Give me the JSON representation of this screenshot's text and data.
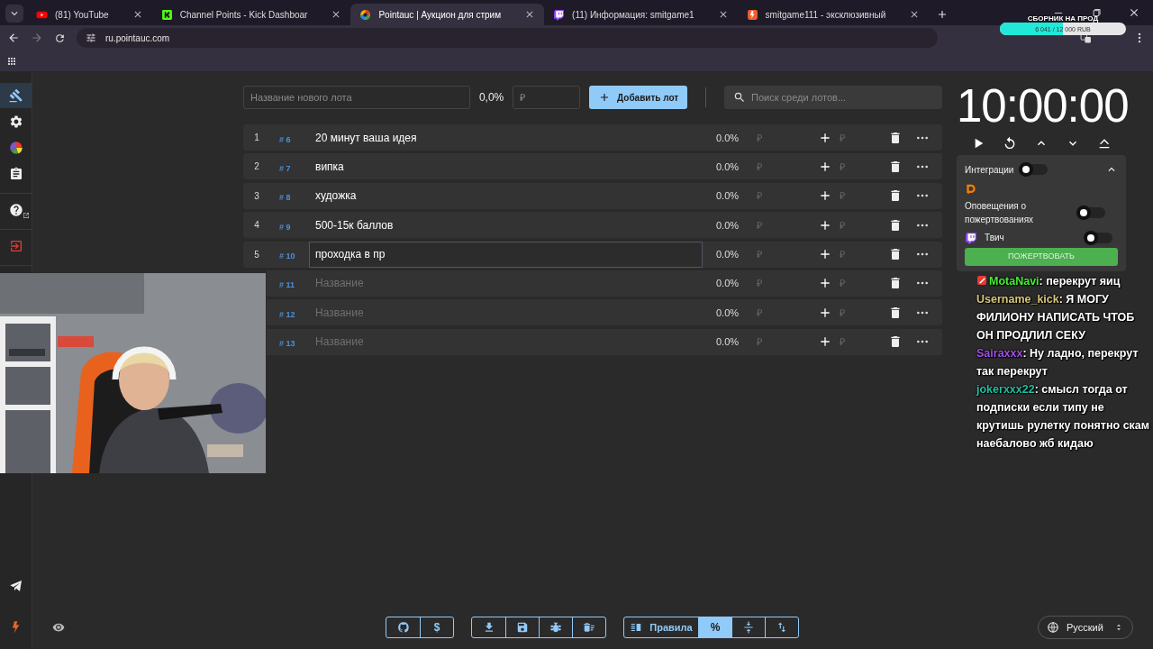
{
  "browser": {
    "tabs": [
      {
        "kind": "youtube",
        "title": "(81) YouTube",
        "selected": false
      },
      {
        "kind": "kick",
        "title": "Channel Points - Kick Dashboar",
        "selected": false
      },
      {
        "kind": "pointauc",
        "title": "Pointauc | Аукцион для стрим",
        "selected": true
      },
      {
        "kind": "twitch",
        "title": "(11) Информация: smitgame1",
        "selected": false
      },
      {
        "kind": "boosty",
        "title": "smitgame111 - эксклюзивный",
        "selected": false
      }
    ],
    "url": "ru.pointauc.com"
  },
  "donation_goal": {
    "title": "СБОРНИК НА ПРОД",
    "amount": "6 041 / 12 000 RUB",
    "level": 0.5
  },
  "sidebar": {
    "sections": [
      [
        {
          "kind": "gavel",
          "selected": true
        },
        {
          "kind": "gear",
          "selected": false
        },
        {
          "kind": "pie",
          "selected": false
        },
        {
          "kind": "clipboard",
          "selected": false
        }
      ],
      [
        {
          "kind": "help",
          "selected": false
        }
      ],
      [
        {
          "kind": "logout",
          "selected": false
        }
      ]
    ],
    "footer": [
      {
        "kind": "telegram"
      },
      {
        "kind": "boosty"
      }
    ]
  },
  "new_lot": {
    "name_placeholder": "Название нового лота",
    "percent": "0,0%",
    "amount_placeholder": "₽",
    "add_button": "Добавить лот"
  },
  "search": {
    "placeholder": "Поиск среди лотов..."
  },
  "lots": [
    {
      "number": "1",
      "tag": "# 6",
      "name": "20 минут ваша идея",
      "percent": "0.0%",
      "amount_placeholder": "₽",
      "add_placeholder": "₽",
      "focused": false
    },
    {
      "number": "2",
      "tag": "# 7",
      "name": "випка",
      "percent": "0.0%",
      "amount_placeholder": "₽",
      "add_placeholder": "₽",
      "focused": false
    },
    {
      "number": "3",
      "tag": "# 8",
      "name": "художка",
      "percent": "0.0%",
      "amount_placeholder": "₽",
      "add_placeholder": "₽",
      "focused": false
    },
    {
      "number": "4",
      "tag": "# 9",
      "name": "500-15к баллов",
      "percent": "0.0%",
      "amount_placeholder": "₽",
      "add_placeholder": "₽",
      "focused": false
    },
    {
      "number": "5",
      "tag": "# 10",
      "name": "проходка в пр",
      "percent": "0.0%",
      "amount_placeholder": "₽",
      "add_placeholder": "₽",
      "focused": true
    },
    {
      "tag": "# 11",
      "name_placeholder": "Название",
      "percent": "0.0%",
      "amount_placeholder": "₽",
      "add_placeholder": "₽",
      "focused": false
    },
    {
      "tag": "# 12",
      "name_placeholder": "Название",
      "percent": "0.0%",
      "amount_placeholder": "₽",
      "add_placeholder": "₽",
      "focused": false
    },
    {
      "tag": "# 13",
      "name_placeholder": "Название",
      "percent": "0.0%",
      "amount_placeholder": "₽",
      "add_placeholder": "₽",
      "focused": false
    }
  ],
  "timer": {
    "time": "10:00:00"
  },
  "integrations": {
    "title": "Интеграции",
    "enabled": false,
    "expanded": true,
    "items": [
      {
        "kind": "donationalerts",
        "label": "Оповещения о пожертвованиях",
        "on": false
      },
      {
        "kind": "twitch",
        "label": "Твич",
        "on": false
      }
    ],
    "donate_button": "ПОЖЕРТВОВАТЬ"
  },
  "chat": [
    {
      "user": "MotaNavi",
      "color": "#44ee33",
      "text": ": перекрут яиц",
      "badge": true
    },
    {
      "user": "Username_kick",
      "color": "#d8c67a",
      "text": ": Я МОГУ ФИЛИОНУ НАПИСАТЬ ЧТОБ ОН ПРОДЛИЛ СЕКУ",
      "badge": false
    },
    {
      "user": "Sairaxxx",
      "color": "#a050e0",
      "text": ": Ну ладно, перекрут так перекрут",
      "badge": false
    },
    {
      "user": "jokerxxx22",
      "color": "#20c0a0",
      "text": ": смысл тогда от подписки если типу не крутишь рулетку понятно скам наебалово жб кидаю",
      "badge": false
    }
  ],
  "toolbar": {
    "groups": [
      [
        {
          "kind": "github"
        },
        {
          "kind": "text",
          "label": "$"
        }
      ],
      [
        {
          "kind": "download"
        },
        {
          "kind": "save"
        },
        {
          "kind": "bug"
        },
        {
          "kind": "clear"
        }
      ],
      [
        {
          "kind": "rules",
          "label": "Правила",
          "selected": false
        },
        {
          "kind": "text",
          "label": "%",
          "selected": true
        },
        {
          "kind": "split",
          "selected": false
        },
        {
          "kind": "sort",
          "selected": false
        }
      ]
    ],
    "language": "Русский"
  }
}
